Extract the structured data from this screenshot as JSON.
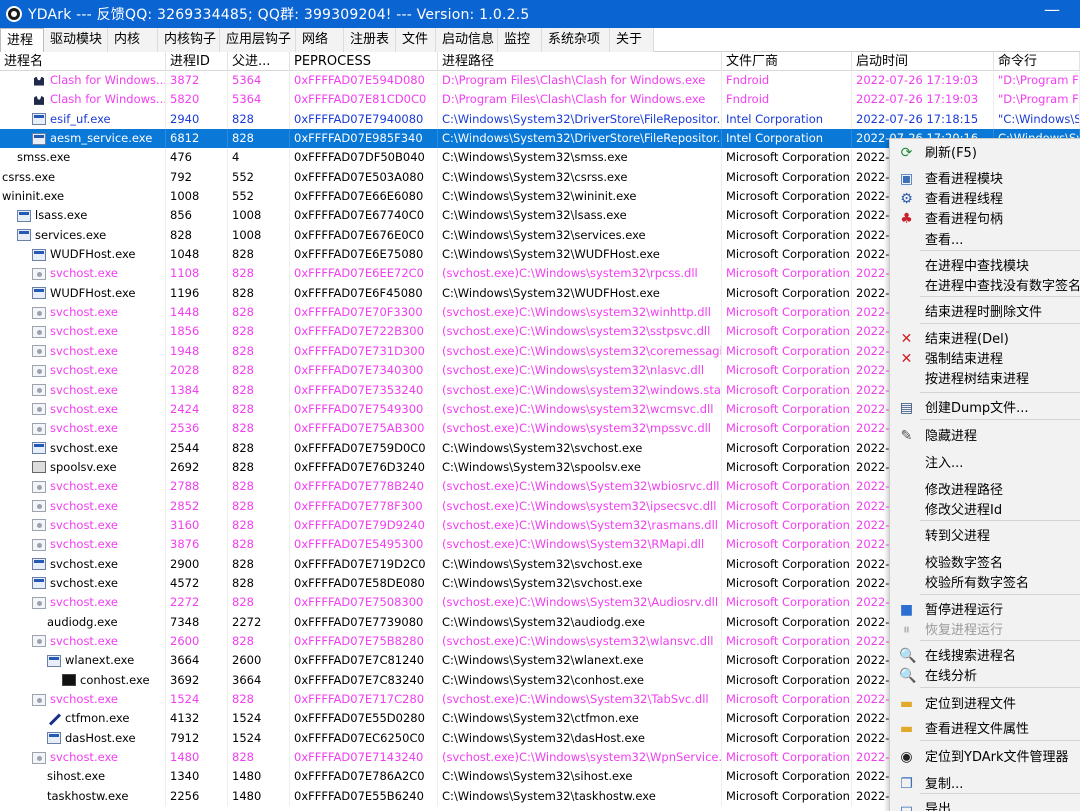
{
  "window": {
    "title": "YDArk --- 反馈QQ: 3269334485; QQ群: 399309204! --- Version: 1.0.2.5",
    "minimize_glyph": "—"
  },
  "tabs": [
    "进程",
    "驱动模块",
    "内核",
    "内核钩子",
    "应用层钩子",
    "网络",
    "注册表",
    "文件",
    "启动信息",
    "监控",
    "系统杂项",
    "关于"
  ],
  "active_tab": 0,
  "columns": [
    "进程名",
    "进程ID",
    "父进...",
    "PEPROCESS",
    "进程路径",
    "文件厂商",
    "启动时间",
    "命令行"
  ],
  "colors": {
    "title_bg": "#0a64d2",
    "selected_row": "#0a78d7",
    "pink_row": "#f13ef1",
    "blue_row": "#1a3ad6"
  },
  "rows": [
    {
      "name": "Clash for Windows...",
      "indent": 2,
      "icon": "clash-icon",
      "pid": "3872",
      "ppid": "5364",
      "eproc": "0xFFFFAD07E594D080",
      "path": "D:\\Program Files\\Clash\\Clash for Windows.exe",
      "vendor": "Fndroid",
      "time": "2022-07-26 17:19:03",
      "cmd": "\"D:\\Program Files",
      "style": "pink"
    },
    {
      "name": "Clash for Windows...",
      "indent": 2,
      "icon": "clash-icon",
      "pid": "5820",
      "ppid": "5364",
      "eproc": "0xFFFFAD07E81CD0C0",
      "path": "D:\\Program Files\\Clash\\Clash for Windows.exe",
      "vendor": "Fndroid",
      "time": "2022-07-26 17:19:03",
      "cmd": "\"D:\\Program Files",
      "style": "pink"
    },
    {
      "name": "esif_uf.exe",
      "indent": 2,
      "icon": "window-icon",
      "pid": "2940",
      "ppid": "828",
      "eproc": "0xFFFFAD07E7940080",
      "path": "C:\\Windows\\System32\\DriverStore\\FileRepositor...",
      "vendor": "Intel Corporation",
      "time": "2022-07-26 17:18:15",
      "cmd": "\"C:\\Windows\\Sys",
      "style": "blue"
    },
    {
      "name": "aesm_service.exe",
      "indent": 2,
      "icon": "window-icon",
      "pid": "6812",
      "ppid": "828",
      "eproc": "0xFFFFAD07E985F340",
      "path": "C:\\Windows\\System32\\DriverStore\\FileRepositor...",
      "vendor": "Intel Corporation",
      "time": "2022-07-26 17:20:16",
      "cmd": "C:\\Windows\\Sys",
      "style": "selected"
    },
    {
      "name": "smss.exe",
      "indent": 1,
      "icon": "none",
      "pid": "476",
      "ppid": "4",
      "eproc": "0xFFFFAD07DF50B040",
      "path": "C:\\Windows\\System32\\smss.exe",
      "vendor": "Microsoft Corporation",
      "time": "2022-0",
      "cmd": "",
      "style": "normal"
    },
    {
      "name": "csrss.exe",
      "indent": 0,
      "icon": "none",
      "pid": "792",
      "ppid": "552",
      "eproc": "0xFFFFAD07E503A080",
      "path": "C:\\Windows\\System32\\csrss.exe",
      "vendor": "Microsoft Corporation",
      "time": "2022-0",
      "cmd": "",
      "style": "normal"
    },
    {
      "name": "wininit.exe",
      "indent": 0,
      "icon": "none",
      "pid": "1008",
      "ppid": "552",
      "eproc": "0xFFFFAD07E66E6080",
      "path": "C:\\Windows\\System32\\wininit.exe",
      "vendor": "Microsoft Corporation",
      "time": "2022-0",
      "cmd": "",
      "style": "normal"
    },
    {
      "name": "lsass.exe",
      "indent": 1,
      "icon": "window-icon",
      "pid": "856",
      "ppid": "1008",
      "eproc": "0xFFFFAD07E67740C0",
      "path": "C:\\Windows\\System32\\lsass.exe",
      "vendor": "Microsoft Corporation",
      "time": "2022-0",
      "cmd": "",
      "style": "normal"
    },
    {
      "name": "services.exe",
      "indent": 1,
      "icon": "window-icon",
      "pid": "828",
      "ppid": "1008",
      "eproc": "0xFFFFAD07E676E0C0",
      "path": "C:\\Windows\\System32\\services.exe",
      "vendor": "Microsoft Corporation",
      "time": "2022-0",
      "cmd": "",
      "style": "normal"
    },
    {
      "name": "WUDFHost.exe",
      "indent": 2,
      "icon": "window-icon",
      "pid": "1048",
      "ppid": "828",
      "eproc": "0xFFFFAD07E6E75080",
      "path": "C:\\Windows\\System32\\WUDFHost.exe",
      "vendor": "Microsoft Corporation",
      "time": "2022-0",
      "cmd": "",
      "style": "normal"
    },
    {
      "name": "svchost.exe",
      "indent": 2,
      "icon": "gear-icon",
      "pid": "1108",
      "ppid": "828",
      "eproc": "0xFFFFAD07E6EE72C0",
      "path": "(svchost.exe)C:\\Windows\\system32\\rpcss.dll",
      "vendor": "Microsoft Corporation",
      "time": "2022-0",
      "cmd": "",
      "style": "pink"
    },
    {
      "name": "WUDFHost.exe",
      "indent": 2,
      "icon": "window-icon",
      "pid": "1196",
      "ppid": "828",
      "eproc": "0xFFFFAD07E6F45080",
      "path": "C:\\Windows\\System32\\WUDFHost.exe",
      "vendor": "Microsoft Corporation",
      "time": "2022-0",
      "cmd": "",
      "style": "normal"
    },
    {
      "name": "svchost.exe",
      "indent": 2,
      "icon": "gear-icon",
      "pid": "1448",
      "ppid": "828",
      "eproc": "0xFFFFAD07E70F3300",
      "path": "(svchost.exe)C:\\Windows\\system32\\winhttp.dll",
      "vendor": "Microsoft Corporation",
      "time": "2022-0",
      "cmd": "",
      "style": "pink"
    },
    {
      "name": "svchost.exe",
      "indent": 2,
      "icon": "gear-icon",
      "pid": "1856",
      "ppid": "828",
      "eproc": "0xFFFFAD07E722B300",
      "path": "(svchost.exe)C:\\Windows\\system32\\sstpsvc.dll",
      "vendor": "Microsoft Corporation",
      "time": "2022-0",
      "cmd": "",
      "style": "pink"
    },
    {
      "name": "svchost.exe",
      "indent": 2,
      "icon": "gear-icon",
      "pid": "1948",
      "ppid": "828",
      "eproc": "0xFFFFAD07E731D300",
      "path": "(svchost.exe)C:\\Windows\\system32\\coremessagi...",
      "vendor": "Microsoft Corporation",
      "time": "2022-0",
      "cmd": "",
      "style": "pink"
    },
    {
      "name": "svchost.exe",
      "indent": 2,
      "icon": "gear-icon",
      "pid": "2028",
      "ppid": "828",
      "eproc": "0xFFFFAD07E7340300",
      "path": "(svchost.exe)C:\\Windows\\system32\\nlasvc.dll",
      "vendor": "Microsoft Corporation",
      "time": "2022-0",
      "cmd": "",
      "style": "pink"
    },
    {
      "name": "svchost.exe",
      "indent": 2,
      "icon": "gear-icon",
      "pid": "1384",
      "ppid": "828",
      "eproc": "0xFFFFAD07E7353240",
      "path": "(svchost.exe)C:\\Windows\\system32\\windows.stat...",
      "vendor": "Microsoft Corporation",
      "time": "2022-0",
      "cmd": "",
      "style": "pink"
    },
    {
      "name": "svchost.exe",
      "indent": 2,
      "icon": "gear-icon",
      "pid": "2424",
      "ppid": "828",
      "eproc": "0xFFFFAD07E7549300",
      "path": "(svchost.exe)C:\\Windows\\system32\\wcmsvc.dll",
      "vendor": "Microsoft Corporation",
      "time": "2022-0",
      "cmd": "",
      "style": "pink"
    },
    {
      "name": "svchost.exe",
      "indent": 2,
      "icon": "gear-icon",
      "pid": "2536",
      "ppid": "828",
      "eproc": "0xFFFFAD07E75AB300",
      "path": "(svchost.exe)C:\\Windows\\system32\\mpssvc.dll",
      "vendor": "Microsoft Corporation",
      "time": "2022-0",
      "cmd": "",
      "style": "pink"
    },
    {
      "name": "svchost.exe",
      "indent": 2,
      "icon": "window-icon",
      "pid": "2544",
      "ppid": "828",
      "eproc": "0xFFFFAD07E759D0C0",
      "path": "C:\\Windows\\System32\\svchost.exe",
      "vendor": "Microsoft Corporation",
      "time": "2022-0",
      "cmd": "",
      "style": "normal"
    },
    {
      "name": "spoolsv.exe",
      "indent": 2,
      "icon": "printer-icon",
      "pid": "2692",
      "ppid": "828",
      "eproc": "0xFFFFAD07E76D3240",
      "path": "C:\\Windows\\System32\\spoolsv.exe",
      "vendor": "Microsoft Corporation",
      "time": "2022-0",
      "cmd": "",
      "style": "normal"
    },
    {
      "name": "svchost.exe",
      "indent": 2,
      "icon": "gear-icon",
      "pid": "2788",
      "ppid": "828",
      "eproc": "0xFFFFAD07E778B240",
      "path": "(svchost.exe)C:\\Windows\\System32\\wbiosrvc.dll",
      "vendor": "Microsoft Corporation",
      "time": "2022-0",
      "cmd": "",
      "style": "pink"
    },
    {
      "name": "svchost.exe",
      "indent": 2,
      "icon": "gear-icon",
      "pid": "2852",
      "ppid": "828",
      "eproc": "0xFFFFAD07E778F300",
      "path": "(svchost.exe)C:\\Windows\\system32\\ipsecsvc.dll",
      "vendor": "Microsoft Corporation",
      "time": "2022-0",
      "cmd": "",
      "style": "pink"
    },
    {
      "name": "svchost.exe",
      "indent": 2,
      "icon": "gear-icon",
      "pid": "3160",
      "ppid": "828",
      "eproc": "0xFFFFAD07E79D9240",
      "path": "(svchost.exe)C:\\Windows\\System32\\rasmans.dll",
      "vendor": "Microsoft Corporation",
      "time": "2022-0",
      "cmd": "",
      "style": "pink"
    },
    {
      "name": "svchost.exe",
      "indent": 2,
      "icon": "gear-icon",
      "pid": "3876",
      "ppid": "828",
      "eproc": "0xFFFFAD07E5495300",
      "path": "(svchost.exe)C:\\Windows\\System32\\RMapi.dll",
      "vendor": "Microsoft Corporation",
      "time": "2022-0",
      "cmd": "",
      "style": "pink"
    },
    {
      "name": "svchost.exe",
      "indent": 2,
      "icon": "window-icon",
      "pid": "2900",
      "ppid": "828",
      "eproc": "0xFFFFAD07E719D2C0",
      "path": "C:\\Windows\\System32\\svchost.exe",
      "vendor": "Microsoft Corporation",
      "time": "2022-0",
      "cmd": "",
      "style": "normal"
    },
    {
      "name": "svchost.exe",
      "indent": 2,
      "icon": "window-icon",
      "pid": "4572",
      "ppid": "828",
      "eproc": "0xFFFFAD07E58DE080",
      "path": "C:\\Windows\\System32\\svchost.exe",
      "vendor": "Microsoft Corporation",
      "time": "2022-0",
      "cmd": "",
      "style": "normal"
    },
    {
      "name": "svchost.exe",
      "indent": 2,
      "icon": "gear-icon",
      "pid": "2272",
      "ppid": "828",
      "eproc": "0xFFFFAD07E7508300",
      "path": "(svchost.exe)C:\\Windows\\System32\\Audiosrv.dll",
      "vendor": "Microsoft Corporation",
      "time": "2022-0",
      "cmd": "",
      "style": "pink"
    },
    {
      "name": "audiodg.exe",
      "indent": 3,
      "icon": "none",
      "pid": "7348",
      "ppid": "2272",
      "eproc": "0xFFFFAD07E7739080",
      "path": "C:\\Windows\\System32\\audiodg.exe",
      "vendor": "Microsoft Corporation",
      "time": "2022-0",
      "cmd": "",
      "style": "normal"
    },
    {
      "name": "svchost.exe",
      "indent": 2,
      "icon": "gear-icon",
      "pid": "2600",
      "ppid": "828",
      "eproc": "0xFFFFAD07E75B8280",
      "path": "(svchost.exe)C:\\Windows\\system32\\wlansvc.dll",
      "vendor": "Microsoft Corporation",
      "time": "2022-0",
      "cmd": "",
      "style": "pink"
    },
    {
      "name": "wlanext.exe",
      "indent": 3,
      "icon": "window-icon",
      "pid": "3664",
      "ppid": "2600",
      "eproc": "0xFFFFAD07E7C81240",
      "path": "C:\\Windows\\System32\\wlanext.exe",
      "vendor": "Microsoft Corporation",
      "time": "2022-0",
      "cmd": "",
      "style": "normal"
    },
    {
      "name": "conhost.exe",
      "indent": 4,
      "icon": "console-icon",
      "pid": "3692",
      "ppid": "3664",
      "eproc": "0xFFFFAD07E7C83240",
      "path": "C:\\Windows\\System32\\conhost.exe",
      "vendor": "Microsoft Corporation",
      "time": "2022-0",
      "cmd": "",
      "style": "normal"
    },
    {
      "name": "svchost.exe",
      "indent": 2,
      "icon": "gear-icon",
      "pid": "1524",
      "ppid": "828",
      "eproc": "0xFFFFAD07E717C280",
      "path": "(svchost.exe)C:\\Windows\\System32\\TabSvc.dll",
      "vendor": "Microsoft Corporation",
      "time": "2022-0",
      "cmd": "",
      "style": "pink"
    },
    {
      "name": "ctfmon.exe",
      "indent": 3,
      "icon": "pen-icon",
      "pid": "4132",
      "ppid": "1524",
      "eproc": "0xFFFFAD07E55D0280",
      "path": "C:\\Windows\\System32\\ctfmon.exe",
      "vendor": "Microsoft Corporation",
      "time": "2022-0",
      "cmd": "",
      "style": "normal"
    },
    {
      "name": "dasHost.exe",
      "indent": 3,
      "icon": "window-icon",
      "pid": "7912",
      "ppid": "1524",
      "eproc": "0xFFFFAD07EC6250C0",
      "path": "C:\\Windows\\System32\\dasHost.exe",
      "vendor": "Microsoft Corporation",
      "time": "2022-0",
      "cmd": "",
      "style": "normal"
    },
    {
      "name": "svchost.exe",
      "indent": 2,
      "icon": "gear-icon",
      "pid": "1480",
      "ppid": "828",
      "eproc": "0xFFFFAD07E7143240",
      "path": "(svchost.exe)C:\\Windows\\system32\\WpnService.dll",
      "vendor": "Microsoft Corporation",
      "time": "2022-0",
      "cmd": "",
      "style": "pink"
    },
    {
      "name": "sihost.exe",
      "indent": 3,
      "icon": "none",
      "pid": "1340",
      "ppid": "1480",
      "eproc": "0xFFFFAD07E786A2C0",
      "path": "C:\\Windows\\System32\\sihost.exe",
      "vendor": "Microsoft Corporation",
      "time": "2022-0",
      "cmd": "",
      "style": "normal"
    },
    {
      "name": "taskhostw.exe",
      "indent": 3,
      "icon": "none",
      "pid": "2256",
      "ppid": "1480",
      "eproc": "0xFFFFAD07E55B6240",
      "path": "C:\\Windows\\System32\\taskhostw.exe",
      "vendor": "Microsoft Corporation",
      "time": "2022-0",
      "cmd": "",
      "style": "normal"
    }
  ],
  "context_menu": {
    "items": [
      {
        "label": "刷新(F5)",
        "icon": "refresh-icon",
        "glyph": "⟳",
        "color": "#1f8a3a",
        "disabled": false
      },
      {
        "label": "查看进程模块",
        "icon": "modules-icon",
        "glyph": "▣",
        "color": "#3b6fb8",
        "disabled": false
      },
      {
        "label": "查看进程线程",
        "icon": "threads-icon",
        "glyph": "⚙",
        "color": "#2d5aa8",
        "disabled": false
      },
      {
        "label": "查看进程句柄",
        "icon": "handles-icon",
        "glyph": "♣",
        "color": "#c8202a",
        "disabled": false
      },
      {
        "label": "查看...",
        "icon": "none",
        "glyph": "",
        "color": "",
        "disabled": false
      },
      {
        "label": "在进程中查找模块",
        "icon": "none",
        "glyph": "",
        "color": "",
        "disabled": false
      },
      {
        "label": "在进程中查找没有数字签名",
        "icon": "none",
        "glyph": "",
        "color": "",
        "disabled": false
      },
      {
        "label": "结束进程时删除文件",
        "icon": "none",
        "glyph": "",
        "color": "",
        "disabled": false
      },
      {
        "label": "结束进程(Del)",
        "icon": "kill-icon",
        "glyph": "✕",
        "color": "#d0202a",
        "disabled": false
      },
      {
        "label": "强制结束进程",
        "icon": "force-kill-icon",
        "glyph": "✕",
        "color": "#d0202a",
        "disabled": false
      },
      {
        "label": "按进程树结束进程",
        "icon": "none",
        "glyph": "",
        "color": "",
        "disabled": false
      },
      {
        "label": "创建Dump文件...",
        "icon": "dump-icon",
        "glyph": "▤",
        "color": "#2f4f7a",
        "disabled": false
      },
      {
        "label": "隐藏进程",
        "icon": "hide-icon",
        "glyph": "✎",
        "color": "#555555",
        "disabled": false
      },
      {
        "label": "注入...",
        "icon": "none",
        "glyph": "",
        "color": "",
        "disabled": false
      },
      {
        "label": "修改进程路径",
        "icon": "none",
        "glyph": "",
        "color": "",
        "disabled": false
      },
      {
        "label": "修改父进程Id",
        "icon": "none",
        "glyph": "",
        "color": "",
        "disabled": false
      },
      {
        "label": "转到父进程",
        "icon": "none",
        "glyph": "",
        "color": "",
        "disabled": false
      },
      {
        "label": "校验数字签名",
        "icon": "none",
        "glyph": "",
        "color": "",
        "disabled": false
      },
      {
        "label": "校验所有数字签名",
        "icon": "none",
        "glyph": "",
        "color": "",
        "disabled": false
      },
      {
        "label": "暂停进程运行",
        "icon": "pause-icon",
        "glyph": "■",
        "color": "#2d6fd0",
        "disabled": false
      },
      {
        "label": "恢复进程运行",
        "icon": "resume-icon",
        "glyph": "⏸",
        "color": "#b5b5b5",
        "disabled": true
      },
      {
        "label": "在线搜索进程名",
        "icon": "search-icon",
        "glyph": "🔍",
        "color": "#2d5aa8",
        "disabled": false
      },
      {
        "label": "在线分析",
        "icon": "analyze-icon",
        "glyph": "🔍",
        "color": "#2d5aa8",
        "disabled": false
      },
      {
        "label": "定位到进程文件",
        "icon": "folder-icon",
        "glyph": "▬",
        "color": "#e0a92a",
        "disabled": false
      },
      {
        "label": "查看进程文件属性",
        "icon": "properties-icon",
        "glyph": "▬",
        "color": "#e0a92a",
        "disabled": false
      },
      {
        "label": "定位到YDArk文件管理器",
        "icon": "ydark-icon",
        "glyph": "◉",
        "color": "#222222",
        "disabled": false
      },
      {
        "label": "复制...",
        "icon": "copy-icon",
        "glyph": "❐",
        "color": "#3b6fb8",
        "disabled": false
      },
      {
        "label": "导出",
        "icon": "export-icon",
        "glyph": "▭",
        "color": "#3b6fb8",
        "disabled": false
      }
    ]
  }
}
